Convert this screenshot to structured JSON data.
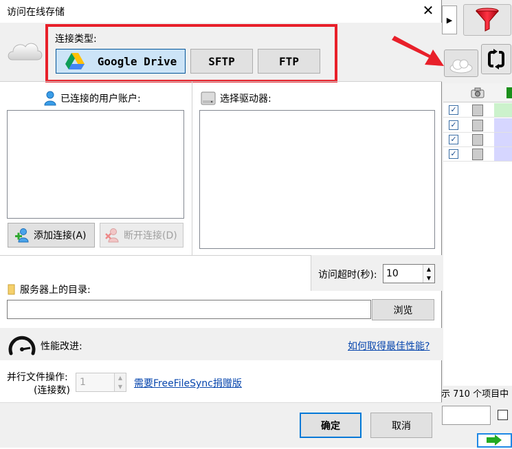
{
  "dialog": {
    "title": "访问在线存储",
    "close_glyph": "✕"
  },
  "connection": {
    "label": "连接类型:",
    "types": [
      "Google Drive",
      "SFTP",
      "FTP"
    ],
    "selected": "Google Drive"
  },
  "accounts": {
    "label": "已连接的用户账户:",
    "add_button": "添加连接(A)",
    "disconnect_button": "断开连接(D)"
  },
  "drives": {
    "label": "选择驱动器:"
  },
  "timeout": {
    "label": "访问超时(秒):",
    "value": "10"
  },
  "server_dir": {
    "label": "服务器上的目录:",
    "value": "",
    "browse_button": "浏览"
  },
  "performance": {
    "label": "性能改进:",
    "link": "如何取得最佳性能?"
  },
  "parallel": {
    "label_line1": "并行文件操作:",
    "label_line2": "(连接数)",
    "value": "1",
    "link": "需要FreeFileSync捐赠版"
  },
  "footer": {
    "ok": "确定",
    "cancel": "取消"
  },
  "background": {
    "status_text": "示 710 个项目中",
    "rows_checked": [
      true,
      true,
      true,
      true
    ],
    "arrow_glyph": "▶"
  },
  "colors": {
    "highlight_box": "#e8202a",
    "selected_button": "#cce4f7",
    "link": "#0645ad"
  }
}
